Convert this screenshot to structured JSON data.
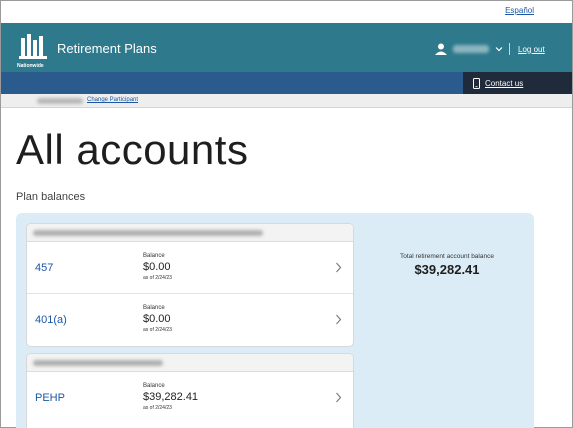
{
  "top": {
    "language_link": "Español"
  },
  "header": {
    "logo_text": "Nationwide",
    "app_title": "Retirement Plans",
    "logout": "Log out"
  },
  "navbar": {
    "contact": "Contact us"
  },
  "participant": {
    "change_link": "Change Participant"
  },
  "page": {
    "title": "All accounts",
    "section_label": "Plan balances"
  },
  "plans": [
    {
      "accounts": [
        {
          "name": "457",
          "balance_label": "Balance",
          "balance": "$0.00",
          "as_of": "as of 2/24/23"
        },
        {
          "name": "401(a)",
          "balance_label": "Balance",
          "balance": "$0.00",
          "as_of": "as of 2/24/23"
        }
      ]
    },
    {
      "accounts": [
        {
          "name": "PEHP",
          "balance_label": "Balance",
          "balance": "$39,282.41",
          "as_of": "as of 2/24/23"
        }
      ]
    }
  ],
  "total": {
    "label": "Total retirement account balance",
    "value": "$39,282.41"
  },
  "colors": {
    "header_teal": "#2e7a8c",
    "nav_blue": "#2b5a8c",
    "contact_dark": "#1f2a3a",
    "panel_blue": "#dcecf7",
    "link_blue": "#1c57a5"
  },
  "icons": [
    "nationwide-logo",
    "user-icon",
    "chevron-down-icon",
    "phone-icon",
    "chevron-right-icon"
  ]
}
